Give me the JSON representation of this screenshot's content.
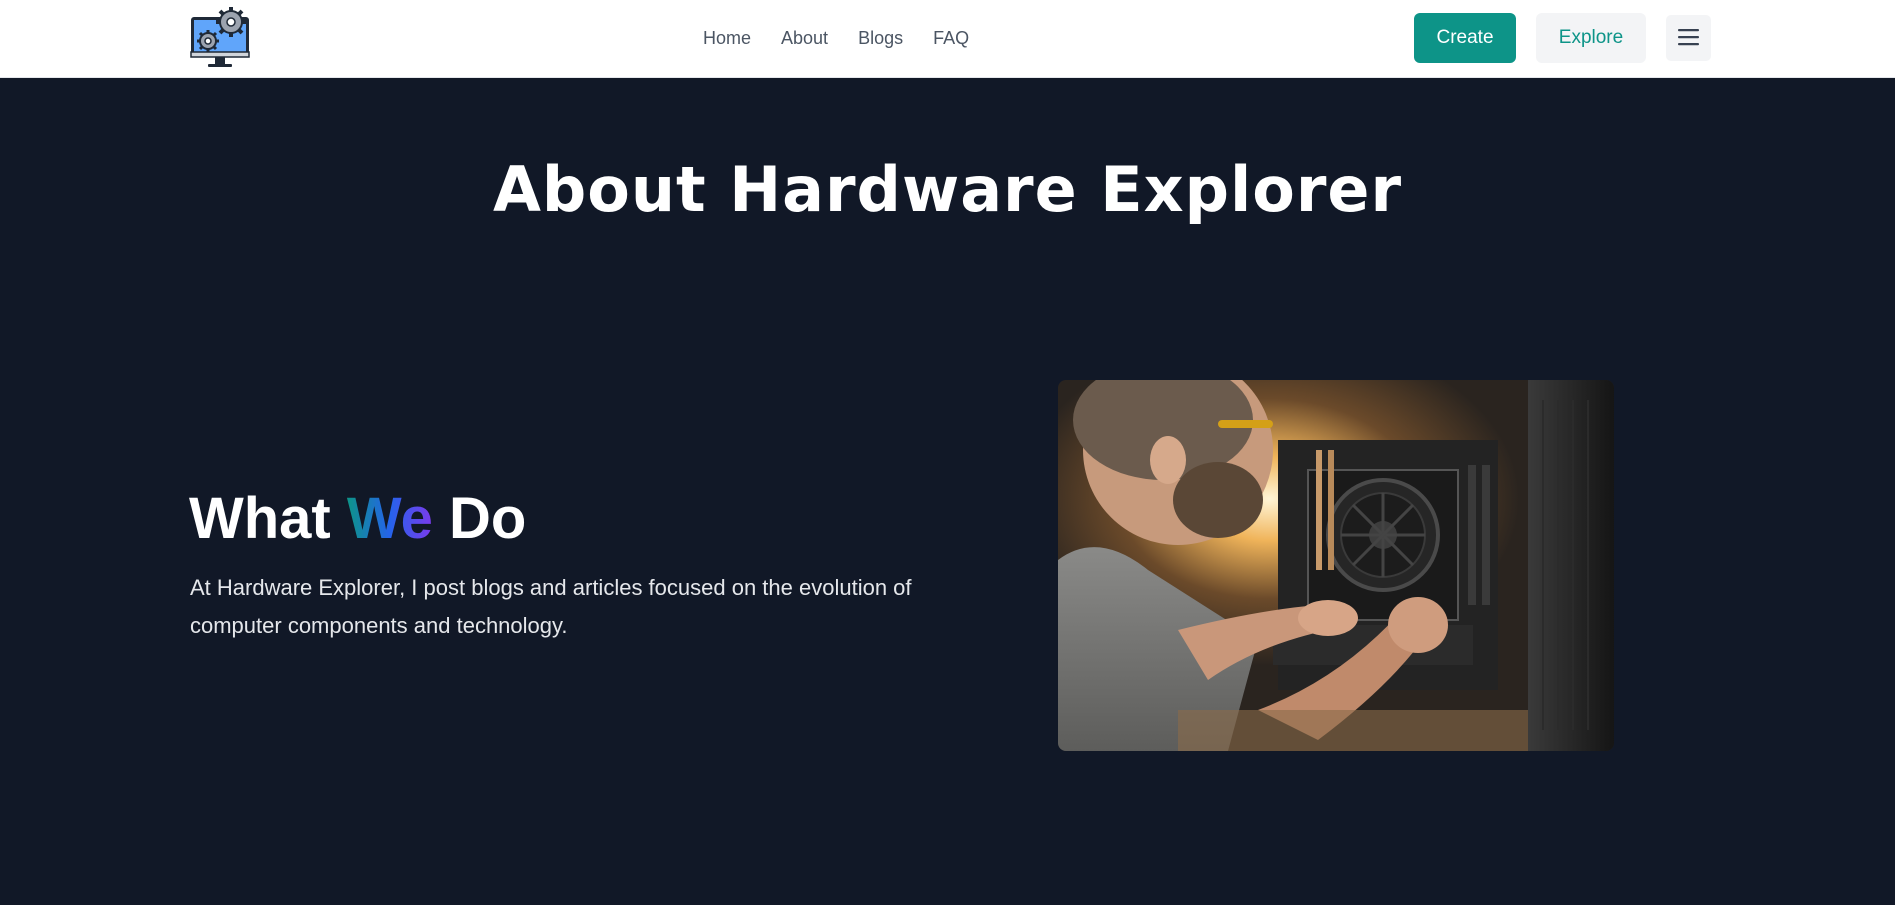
{
  "nav": {
    "logo_icon": "computer-gears-icon",
    "links": [
      "Home",
      "About",
      "Blogs",
      "FAQ"
    ],
    "create_label": "Create",
    "explore_label": "Explore",
    "menu_icon": "hamburger-menu-icon"
  },
  "hero": {
    "title": "About Hardware Explorer"
  },
  "what_we_do": {
    "heading_before": "What",
    "heading_highlight": "We",
    "heading_after": "Do",
    "text": "At Hardware Explorer, I post blogs and articles focused on the evolution of computer components and technology.",
    "image_icon": "technician-building-pc-photo"
  },
  "colors": {
    "nav_bg": "#ffffff",
    "page_bg": "#111827",
    "accent": "#0d9488",
    "explore_bg": "#f3f4f6",
    "gradient": [
      "#0d9488",
      "#2563eb",
      "#7c3aed"
    ]
  }
}
